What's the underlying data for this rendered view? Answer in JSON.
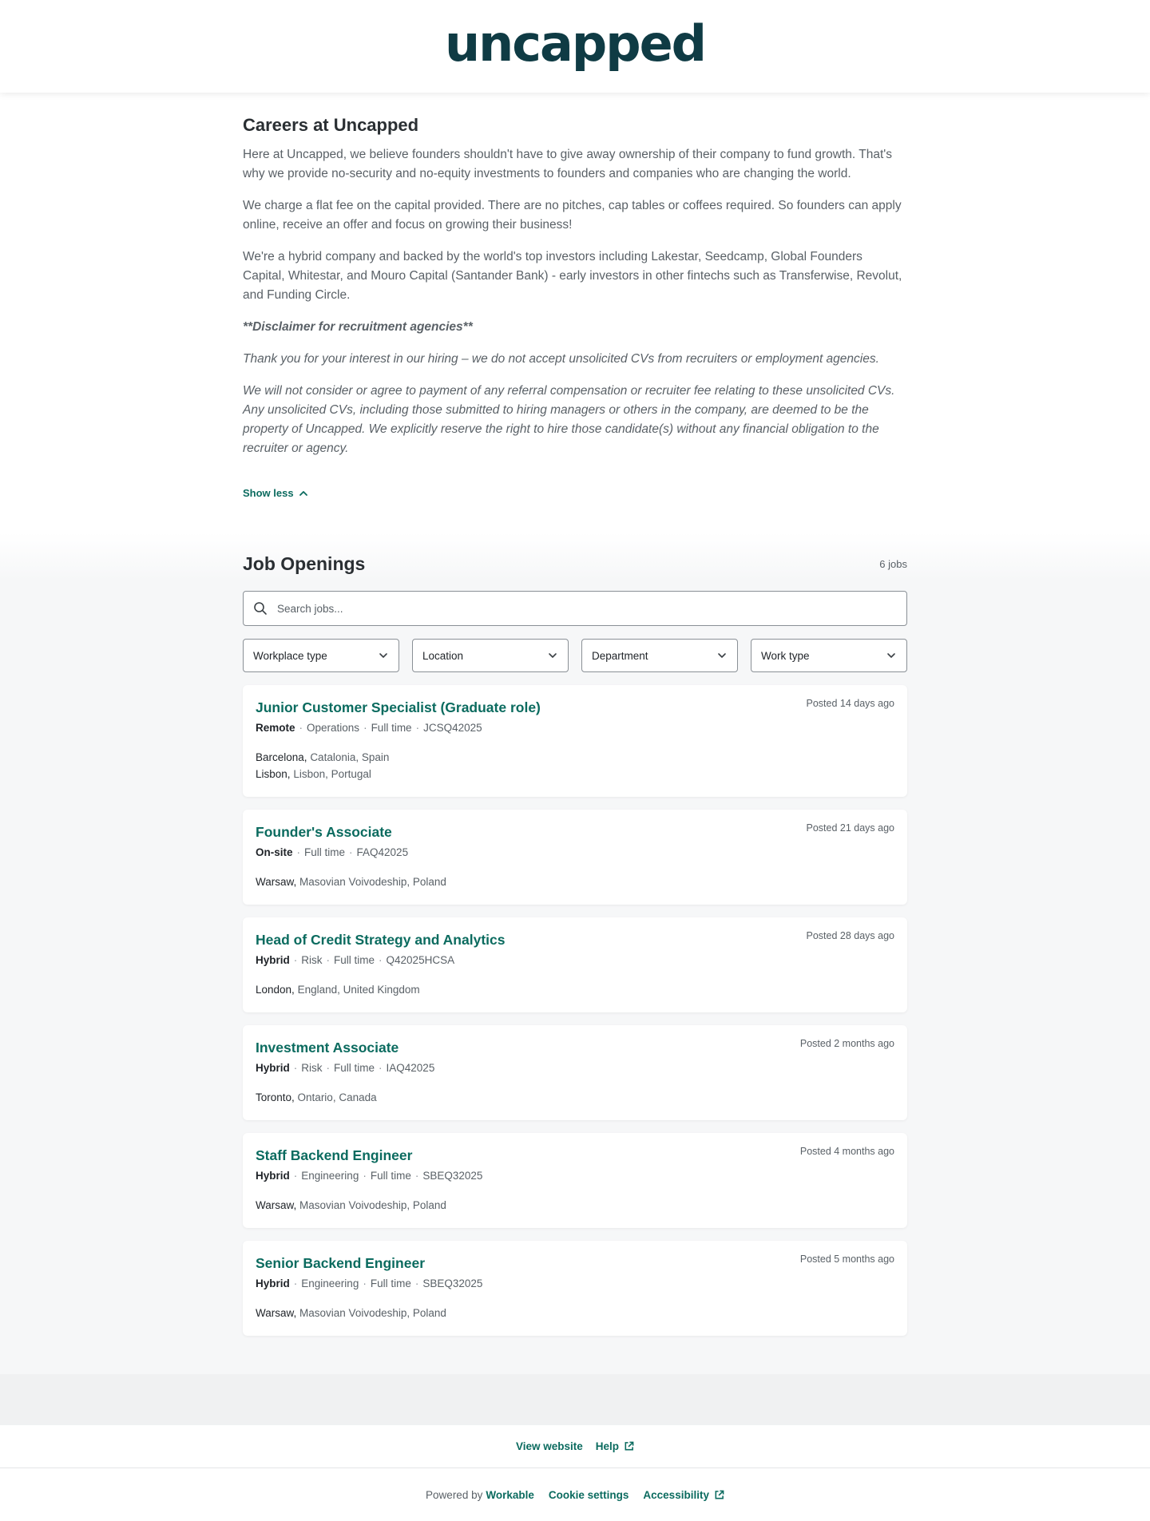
{
  "header": {
    "logo_text": "uncapped"
  },
  "about": {
    "title": "Careers at Uncapped",
    "paragraphs": [
      "Here at Uncapped, we believe founders shouldn't have to give away ownership of their company to fund growth. That's why we provide no-security and no-equity investments to founders and companies who are changing the world.",
      "We charge a flat fee on the capital provided. There are no pitches, cap tables or coffees required. So founders can apply online, receive an offer and focus on growing their business!",
      "We're a hybrid company and backed by the world's top investors including Lakestar, Seedcamp, Global Founders Capital, Whitestar, and Mouro Capital (Santander Bank) - early investors in other fintechs such as Transferwise, Revolut, and Funding Circle."
    ],
    "disclaimer_heading": "**Disclaimer for recruitment agencies**",
    "disclaimer_1": "Thank you for your interest in our hiring – we do not accept unsolicited CVs from recruiters or employment agencies.",
    "disclaimer_2": "We will not consider or agree to payment of any referral compensation or recruiter fee relating to these unsolicited CVs. Any unsolicited CVs, including those submitted to hiring managers or others in the company, are deemed to be the property of Uncapped. We explicitly reserve the right to hire those candidate(s) without any financial obligation to the recruiter or agency.",
    "show_less_label": "Show less"
  },
  "jobs": {
    "title": "Job Openings",
    "count": "6 jobs",
    "search_placeholder": "Search jobs...",
    "filters": [
      "Workplace type",
      "Location",
      "Department",
      "Work type"
    ],
    "list": [
      {
        "title": "Junior Customer Specialist (Graduate role)",
        "posted": "Posted 14 days ago",
        "workplace": "Remote",
        "meta": [
          "Operations",
          "Full time",
          "JCSQ42025"
        ],
        "locations": [
          {
            "city": "Barcelona,",
            "region": "Catalonia, Spain"
          },
          {
            "city": "Lisbon,",
            "region": "Lisbon, Portugal"
          }
        ]
      },
      {
        "title": "Founder's Associate",
        "posted": "Posted 21 days ago",
        "workplace": "On-site",
        "meta": [
          "Full time",
          "FAQ42025"
        ],
        "locations": [
          {
            "city": "Warsaw,",
            "region": "Masovian Voivodeship, Poland"
          }
        ]
      },
      {
        "title": "Head of Credit Strategy and Analytics",
        "posted": "Posted 28 days ago",
        "workplace": "Hybrid",
        "meta": [
          "Risk",
          "Full time",
          "Q42025HCSA"
        ],
        "locations": [
          {
            "city": "London,",
            "region": "England, United Kingdom"
          }
        ]
      },
      {
        "title": "Investment Associate",
        "posted": "Posted 2 months ago",
        "workplace": "Hybrid",
        "meta": [
          "Risk",
          "Full time",
          "IAQ42025"
        ],
        "locations": [
          {
            "city": "Toronto,",
            "region": "Ontario, Canada"
          }
        ]
      },
      {
        "title": "Staff Backend Engineer",
        "posted": "Posted 4 months ago",
        "workplace": "Hybrid",
        "meta": [
          "Engineering",
          "Full time",
          "SBEQ32025"
        ],
        "locations": [
          {
            "city": "Warsaw,",
            "region": "Masovian Voivodeship, Poland"
          }
        ]
      },
      {
        "title": "Senior Backend Engineer",
        "posted": "Posted 5 months ago",
        "workplace": "Hybrid",
        "meta": [
          "Engineering",
          "Full time",
          "SBEQ32025"
        ],
        "locations": [
          {
            "city": "Warsaw,",
            "region": "Masovian Voivodeship, Poland"
          }
        ]
      }
    ]
  },
  "footer": {
    "view_website": "View website",
    "help": "Help",
    "powered_by": "Powered by",
    "workable": "Workable",
    "cookie_settings": "Cookie settings",
    "accessibility": "Accessibility"
  },
  "colors": {
    "accent": "#0b6b5f",
    "logo": "#0f3b44",
    "page_bg": "#f6f7f8"
  }
}
